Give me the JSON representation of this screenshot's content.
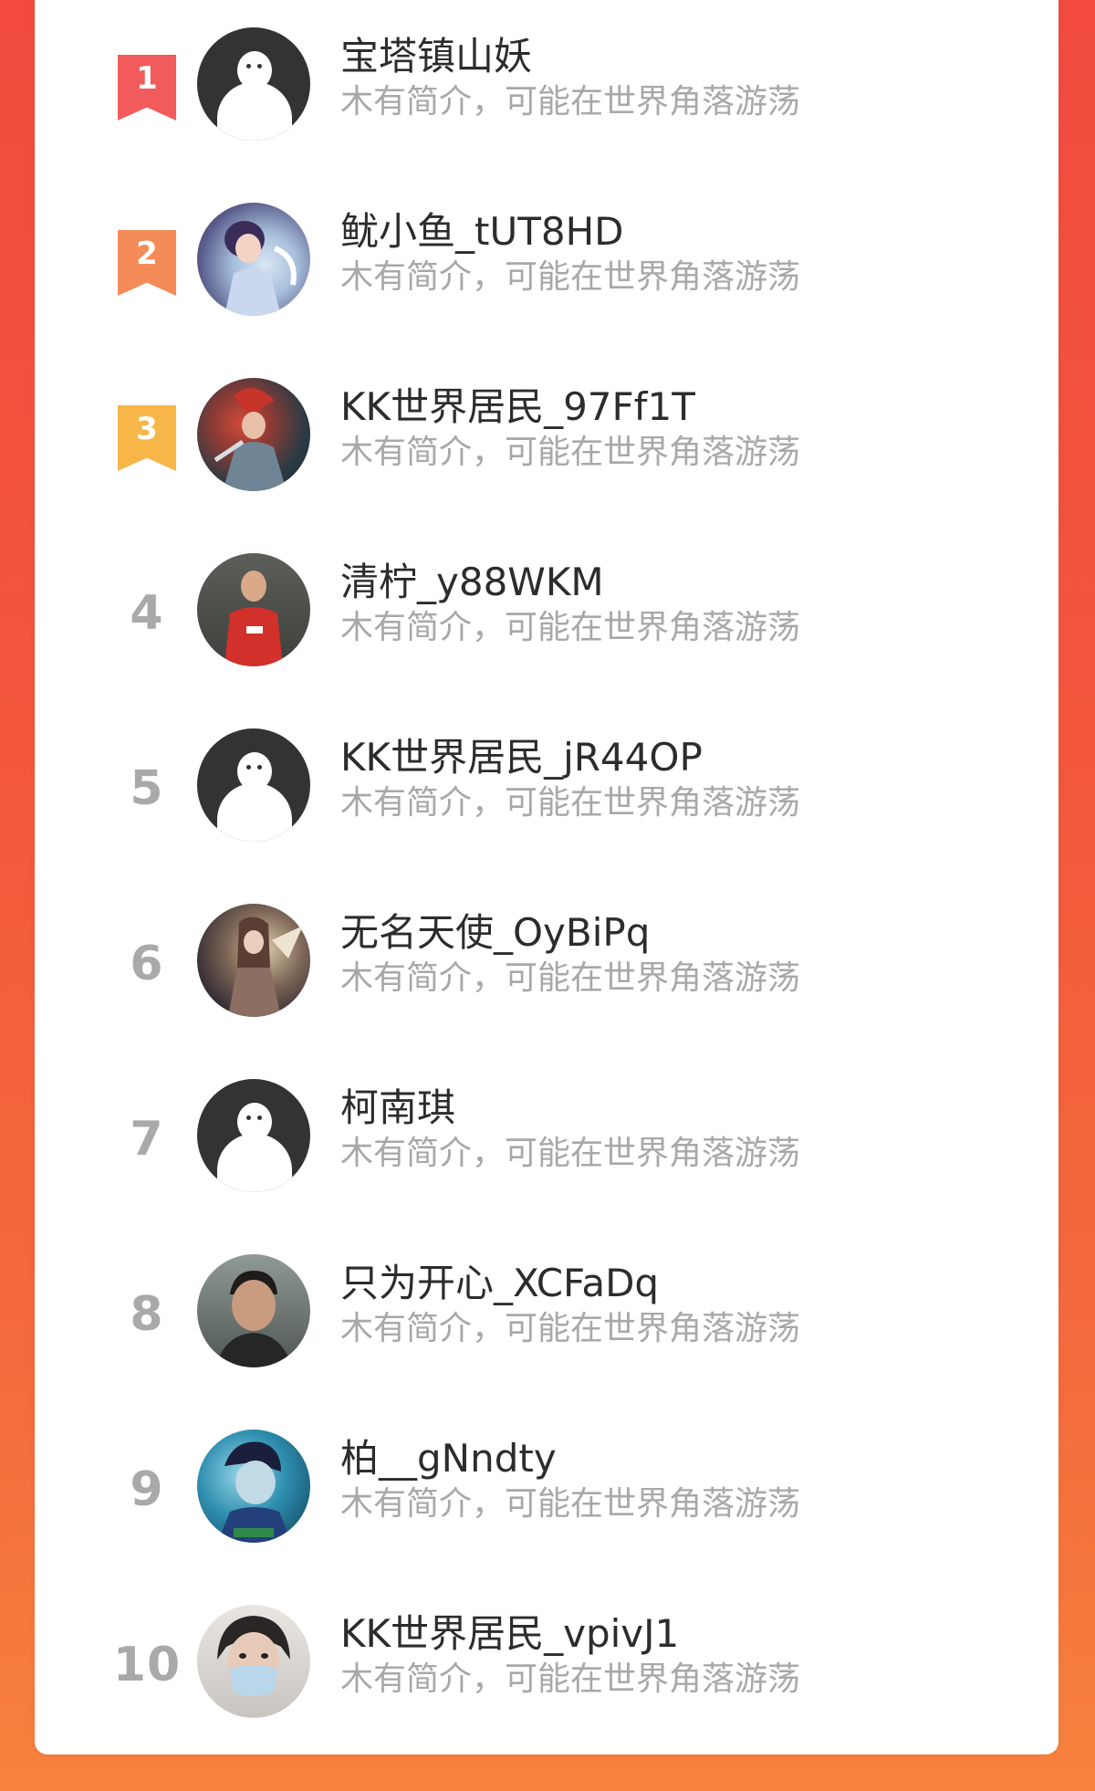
{
  "ranking": {
    "items": [
      {
        "rank": "1",
        "name": "宝塔镇山妖",
        "bio": "木有简介，可能在世界角落游荡",
        "avatar": "default-avatar",
        "badge_color": "#f15b5b"
      },
      {
        "rank": "2",
        "name": "鱿小鱼_tUT8HD",
        "bio": "木有简介，可能在世界角落游荡",
        "avatar": "anime-boy-avatar",
        "badge_color": "#f58b58"
      },
      {
        "rank": "3",
        "name": "KK世界居民_97Ff1T",
        "bio": "木有简介，可能在世界角落游荡",
        "avatar": "game-hero-avatar",
        "badge_color": "#f7b648"
      },
      {
        "rank": "4",
        "name": "清柠_y88WKM",
        "bio": "木有简介，可能在世界角落游荡",
        "avatar": "football-player-avatar"
      },
      {
        "rank": "5",
        "name": "KK世界居民_jR44OP",
        "bio": "木有简介，可能在世界角落游荡",
        "avatar": "default-avatar"
      },
      {
        "rank": "6",
        "name": "无名天使_OyBiPq",
        "bio": "木有简介，可能在世界角落游荡",
        "avatar": "anime-character-avatar"
      },
      {
        "rank": "7",
        "name": "柯南琪",
        "bio": "木有简介，可能在世界角落游荡",
        "avatar": "default-avatar"
      },
      {
        "rank": "8",
        "name": "只为开心_XCFaDq",
        "bio": "木有简介，可能在世界角落游荡",
        "avatar": "man-portrait-avatar"
      },
      {
        "rank": "9",
        "name": "柏__gNndty",
        "bio": "木有简介，可能在世界角落游荡",
        "avatar": "anime-boy-blue-avatar"
      },
      {
        "rank": "10",
        "name": "KK世界居民_vpivJ1",
        "bio": "木有简介，可能在世界角落游荡",
        "avatar": "masked-person-avatar"
      }
    ]
  }
}
